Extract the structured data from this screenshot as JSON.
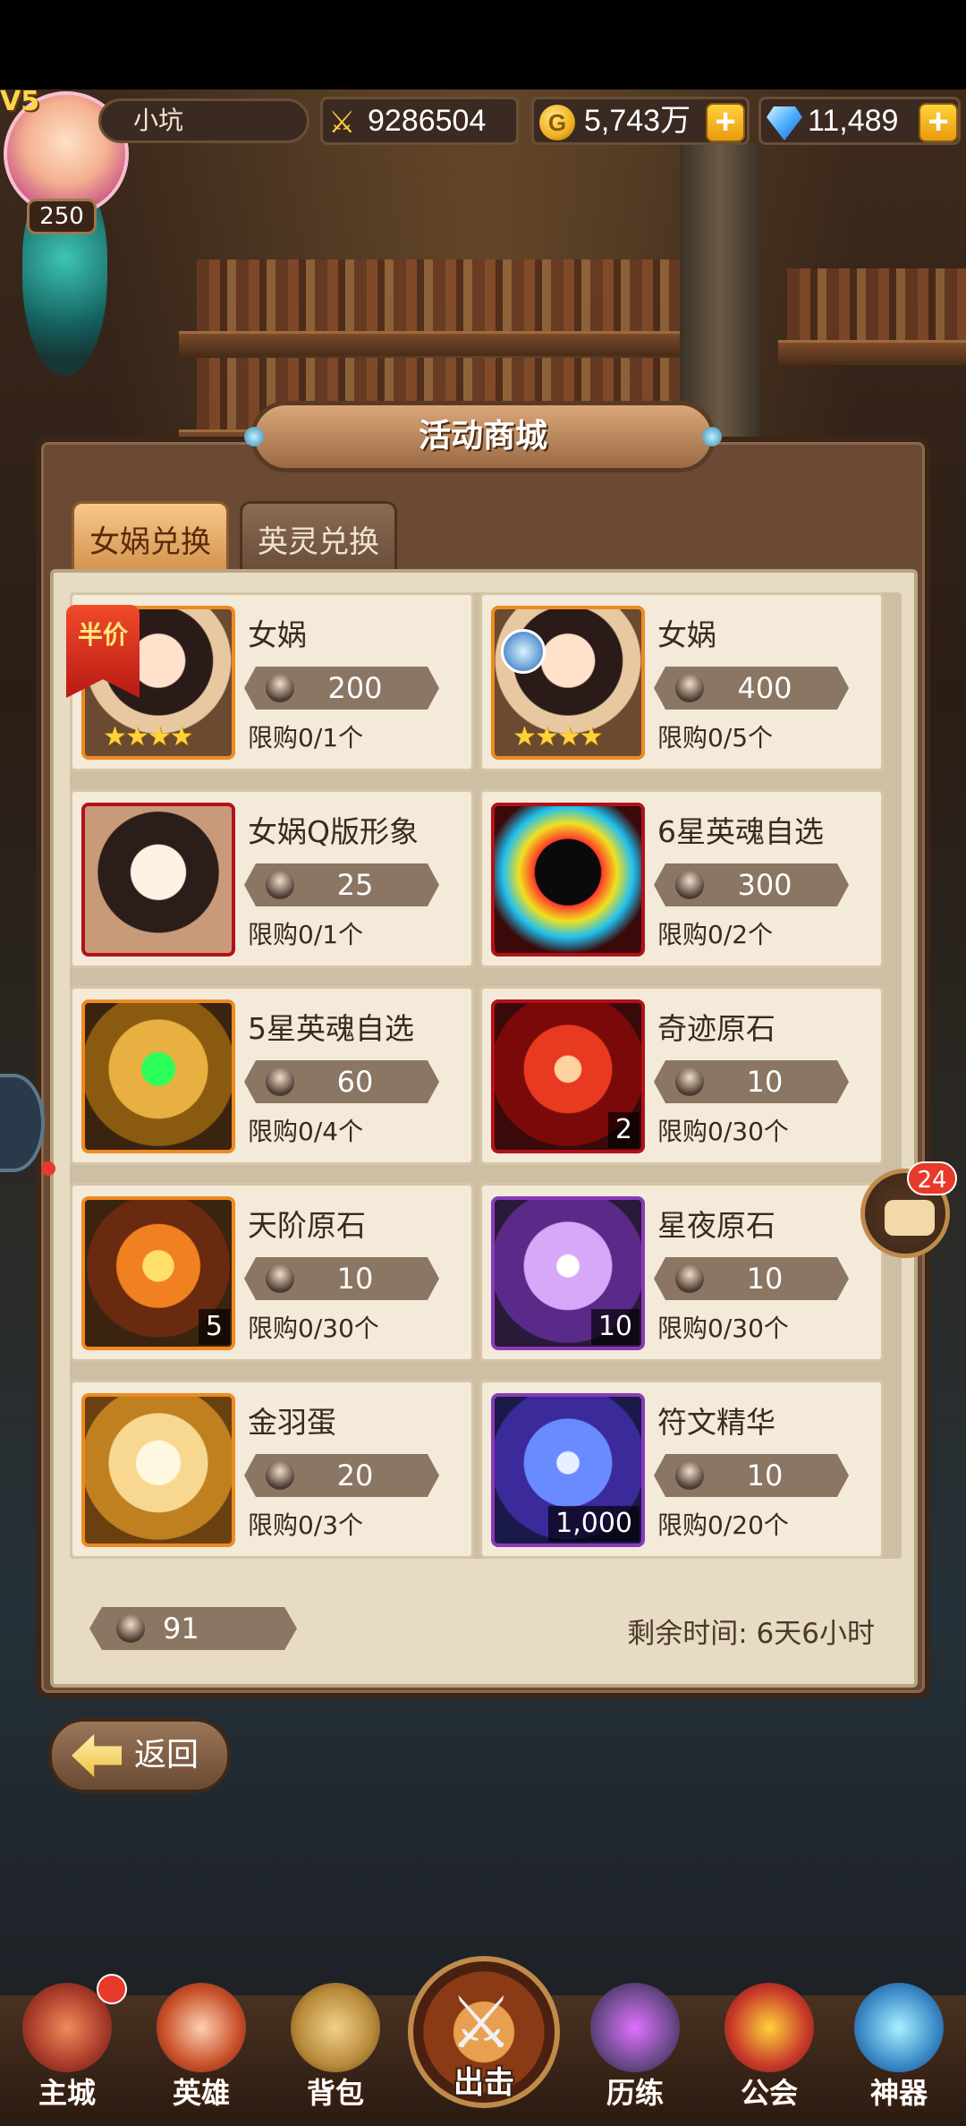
{
  "player": {
    "level": "V5",
    "energy": "250",
    "name": "小坑",
    "power": "9286504",
    "gold": "5,743万",
    "gems": "11,489",
    "plus": "+"
  },
  "shop": {
    "title": "活动商城",
    "tabs": [
      {
        "label": "女娲兑换",
        "active": true
      },
      {
        "label": "英灵兑换",
        "active": false
      }
    ],
    "half_price_badge": "半价",
    "items": [
      {
        "name": "女娲",
        "price": "200",
        "limit": "限购0/1个",
        "qty": "",
        "art": "nuwa",
        "frame": "orange"
      },
      {
        "name": "女娲",
        "price": "400",
        "limit": "限购0/5个",
        "qty": "",
        "art": "nuwa",
        "frame": "orange"
      },
      {
        "name": "女娲Q版形象",
        "price": "25",
        "limit": "限购0/1个",
        "qty": "",
        "art": "nuwa-chibi",
        "frame": "red"
      },
      {
        "name": "6星英魂自选",
        "price": "300",
        "limit": "限购0/2个",
        "qty": "",
        "art": "hero-soul-6",
        "frame": "red"
      },
      {
        "name": "5星英魂自选",
        "price": "60",
        "limit": "限购0/4个",
        "qty": "",
        "art": "hero-soul-5",
        "frame": "orange"
      },
      {
        "name": "奇迹原石",
        "price": "10",
        "limit": "限购0/30个",
        "qty": "2",
        "art": "miracle-stone",
        "frame": "red"
      },
      {
        "name": "天阶原石",
        "price": "10",
        "limit": "限购0/30个",
        "qty": "5",
        "art": "heaven-stone",
        "frame": "orange"
      },
      {
        "name": "星夜原石",
        "price": "10",
        "limit": "限购0/30个",
        "qty": "10",
        "art": "starry-stone",
        "frame": "purple"
      },
      {
        "name": "金羽蛋",
        "price": "20",
        "limit": "限购0/3个",
        "qty": "",
        "art": "golden-egg",
        "frame": "orange"
      },
      {
        "name": "符文精华",
        "price": "10",
        "limit": "限购0/20个",
        "qty": "1,000",
        "art": "rune-essence",
        "frame": "purple"
      }
    ],
    "stars": "★★★★",
    "balance": "91",
    "remaining_time": "剩余时间: 6天6小时"
  },
  "back_label": "返回",
  "chat_badge": "24",
  "nav": [
    {
      "label": "主城",
      "icon": "castle-icon"
    },
    {
      "label": "英雄",
      "icon": "hero-icon"
    },
    {
      "label": "背包",
      "icon": "backpack-icon"
    },
    {
      "label": "出击",
      "icon": "crossed-swords-icon"
    },
    {
      "label": "历练",
      "icon": "training-icon"
    },
    {
      "label": "公会",
      "icon": "guild-icon"
    },
    {
      "label": "神器",
      "icon": "artifact-icon"
    }
  ],
  "colors": {
    "panel": "#6a4a34",
    "card": "#f3ead9",
    "price_pill": "#8a7663",
    "tab_active": "#f7c88a",
    "badge_red": "#e83a2a"
  }
}
